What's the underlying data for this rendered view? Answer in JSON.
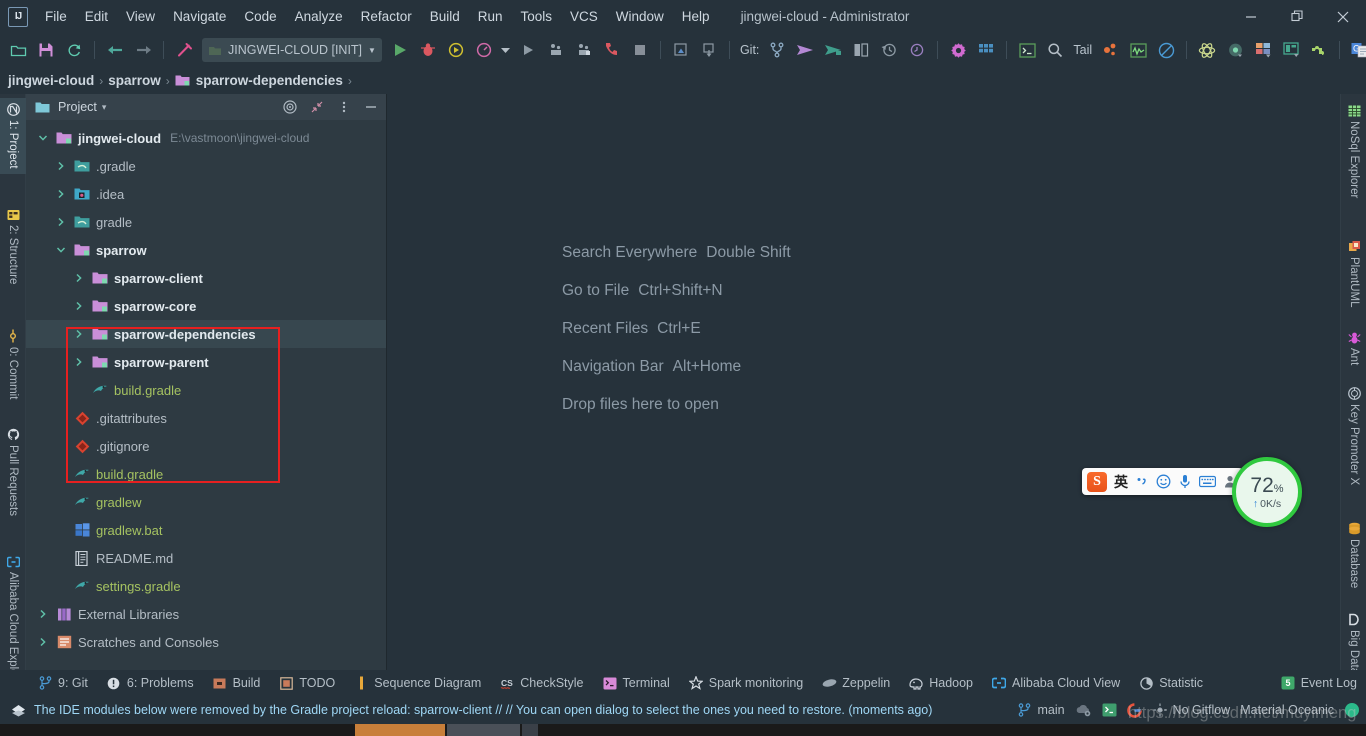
{
  "window": {
    "title": "jingwei-cloud - Administrator",
    "minimize_label": "─",
    "maximize_label": "❐",
    "close_label": "✕",
    "logo_text": "IJ"
  },
  "menubar": {
    "items": [
      {
        "label": "File",
        "mnemonic": "F"
      },
      {
        "label": "Edit",
        "mnemonic": "E"
      },
      {
        "label": "View",
        "mnemonic": "V"
      },
      {
        "label": "Navigate",
        "mnemonic": "N"
      },
      {
        "label": "Code",
        "mnemonic": "C"
      },
      {
        "label": "Analyze",
        "mnemonic": "z"
      },
      {
        "label": "Refactor",
        "mnemonic": "R"
      },
      {
        "label": "Build",
        "mnemonic": "B"
      },
      {
        "label": "Run",
        "mnemonic": "u"
      },
      {
        "label": "Tools",
        "mnemonic": "T"
      },
      {
        "label": "VCS",
        "mnemonic": "S"
      },
      {
        "label": "Window",
        "mnemonic": "W"
      },
      {
        "label": "Help",
        "mnemonic": "H"
      }
    ]
  },
  "toolbar": {
    "run_config": {
      "label": "JINGWEI-CLOUD [INIT]",
      "dropdown": "▼"
    },
    "git_label": "Git:",
    "tail_label": "Tail",
    "icons": [
      "open-folder-icon",
      "save-all-icon",
      "sync-icon",
      "back-icon",
      "forward-icon",
      "build-hammer-icon",
      "run-icon",
      "debug-icon",
      "run-with-coverage-icon",
      "profiler-icon",
      "run-anything-icon",
      "attach-profiler-icon",
      "attach-debugger-icon",
      "stop-call-icon",
      "stop-icon",
      "update-project-icon",
      "commit-icon",
      "vcs-branch-icon",
      "push-icon",
      "pull-icon",
      "compare-icon",
      "history-icon",
      "rollback-icon",
      "settings-gear-icon",
      "project-structure-icon",
      "terminal-icon",
      "search-icon",
      "tail-icon",
      "spark-icon",
      "monitor-icon",
      "no-entry-icon",
      "atom-icon",
      "circle-icon",
      "grid-colors-icon",
      "image-icon",
      "plugin-puzzle-icon",
      "google-translate-icon",
      "translate-red-icon",
      "link-icon"
    ]
  },
  "breadcrumb": {
    "items": [
      {
        "label": "jingwei-cloud",
        "has_icon": false
      },
      {
        "label": "sparrow",
        "has_icon": false
      },
      {
        "label": "sparrow-dependencies",
        "has_icon": true
      }
    ],
    "separator": "›"
  },
  "left_rail": {
    "items": [
      {
        "label": "1: Project",
        "icon": "project-icon",
        "active": true
      },
      {
        "label": "2: Structure",
        "icon": "structure-icon",
        "active": false
      },
      {
        "label": "0: Commit",
        "icon": "commit-icon",
        "active": false
      },
      {
        "label": "Pull Requests",
        "icon": "github-icon",
        "active": false
      },
      {
        "label": "Alibaba Cloud Explorer",
        "icon": "alibaba-cloud-icon",
        "active": false
      }
    ]
  },
  "right_rail": {
    "items": [
      {
        "label": "NoSql Explorer",
        "icon": "nosql-table-icon"
      },
      {
        "label": "PlantUML",
        "icon": "plantuml-icon"
      },
      {
        "label": "Ant",
        "icon": "ant-icon"
      },
      {
        "label": "Key Promoter X",
        "icon": "key-promoter-icon"
      },
      {
        "label": "Database",
        "icon": "database-icon"
      },
      {
        "label": "Big Data Tools",
        "icon": "big-data-tools-icon"
      }
    ]
  },
  "project_panel": {
    "title": "Project",
    "title_dropdown": "∨",
    "buttons": [
      {
        "name": "select-opened-file-icon",
        "label": "◎"
      },
      {
        "name": "collapse-all-icon",
        "label": "↙"
      },
      {
        "name": "options-menu-icon",
        "label": "⋮"
      },
      {
        "name": "hide-panel-icon",
        "label": "—"
      }
    ],
    "tree": [
      {
        "label": "jingwei-cloud",
        "path": "E:\\vastmoon\\jingwei-cloud",
        "depth": 0,
        "twisty": "expanded",
        "icon": "module-icon",
        "bold": true,
        "selected": false
      },
      {
        "label": ".gradle",
        "depth": 1,
        "twisty": "collapsed",
        "icon": "folder-gradle-icon",
        "bold": false,
        "selected": false,
        "color": "gray"
      },
      {
        "label": ".idea",
        "depth": 1,
        "twisty": "collapsed",
        "icon": "folder-idea-icon",
        "bold": false,
        "selected": false,
        "color": "gray"
      },
      {
        "label": "gradle",
        "depth": 1,
        "twisty": "collapsed",
        "icon": "folder-gradle-icon",
        "bold": false,
        "selected": false,
        "color": "gray"
      },
      {
        "label": "sparrow",
        "depth": 1,
        "twisty": "expanded",
        "icon": "module-icon",
        "bold": true,
        "selected": false
      },
      {
        "label": "sparrow-client",
        "depth": 2,
        "twisty": "collapsed",
        "icon": "module-icon",
        "bold": true,
        "selected": false
      },
      {
        "label": "sparrow-core",
        "depth": 2,
        "twisty": "collapsed",
        "icon": "module-icon",
        "bold": true,
        "selected": false
      },
      {
        "label": "sparrow-dependencies",
        "depth": 2,
        "twisty": "collapsed",
        "icon": "module-icon",
        "bold": true,
        "selected": true
      },
      {
        "label": "sparrow-parent",
        "depth": 2,
        "twisty": "collapsed",
        "icon": "module-icon",
        "bold": true,
        "selected": false
      },
      {
        "label": "build.gradle",
        "depth": 2,
        "twisty": "none",
        "icon": "gradle-file-icon",
        "bold": false,
        "selected": false,
        "color": "green"
      },
      {
        "label": ".gitattributes",
        "depth": 1,
        "twisty": "none",
        "icon": "git-file-icon",
        "bold": false,
        "selected": false,
        "color": "gray"
      },
      {
        "label": ".gitignore",
        "depth": 1,
        "twisty": "none",
        "icon": "git-file-icon",
        "bold": false,
        "selected": false,
        "color": "gray"
      },
      {
        "label": "build.gradle",
        "depth": 1,
        "twisty": "none",
        "icon": "gradle-file-icon",
        "bold": false,
        "selected": false,
        "color": "green"
      },
      {
        "label": "gradlew",
        "depth": 1,
        "twisty": "none",
        "icon": "gradle-file-icon",
        "bold": false,
        "selected": false,
        "color": "green"
      },
      {
        "label": "gradlew.bat",
        "depth": 1,
        "twisty": "none",
        "icon": "bat-file-icon",
        "bold": false,
        "selected": false,
        "color": "green"
      },
      {
        "label": "README.md",
        "depth": 1,
        "twisty": "none",
        "icon": "markdown-file-icon",
        "bold": false,
        "selected": false,
        "color": "gray"
      },
      {
        "label": "settings.gradle",
        "depth": 1,
        "twisty": "none",
        "icon": "gradle-file-icon",
        "bold": false,
        "selected": false,
        "color": "green"
      },
      {
        "label": "External Libraries",
        "depth": 0,
        "twisty": "collapsed",
        "icon": "libraries-icon",
        "bold": false,
        "selected": false,
        "color": "gray"
      },
      {
        "label": "Scratches and Consoles",
        "depth": 0,
        "twisty": "collapsed",
        "icon": "scratches-icon",
        "bold": false,
        "selected": false,
        "color": "gray"
      }
    ]
  },
  "editor": {
    "hints": [
      {
        "action": "Search Everywhere",
        "shortcut": "Double Shift"
      },
      {
        "action": "Go to File",
        "shortcut": "Ctrl+Shift+N"
      },
      {
        "action": "Recent Files",
        "shortcut": "Ctrl+E"
      },
      {
        "action": "Navigation Bar",
        "shortcut": "Alt+Home"
      },
      {
        "action": "Drop files here to open",
        "shortcut": ""
      }
    ]
  },
  "ime": {
    "logo": "S",
    "mode_label": "英",
    "icons": [
      "punctuation-icon",
      "emoji-icon",
      "voice-input-icon",
      "soft-keyboard-icon",
      "user-icon"
    ]
  },
  "speed_widget": {
    "percent": "72",
    "percent_unit": "%",
    "rate": "0K/s",
    "arrow": "↑",
    "ring_color": "#30c93f"
  },
  "bottom_bar": {
    "items": [
      {
        "label": "9: Git",
        "mnemonic": "9",
        "icon": "git-branch-icon"
      },
      {
        "label": "6: Problems",
        "mnemonic": "6",
        "icon": "problems-icon"
      },
      {
        "label": "Build",
        "icon": "build-icon"
      },
      {
        "label": "TODO",
        "icon": "todo-icon"
      },
      {
        "label": "Sequence Diagram",
        "icon": "sequence-diagram-icon"
      },
      {
        "label": "CheckStyle",
        "icon": "checkstyle-icon"
      },
      {
        "label": "Terminal",
        "icon": "terminal-icon"
      },
      {
        "label": "Spark monitoring",
        "icon": "spark-star-icon"
      },
      {
        "label": "Zeppelin",
        "icon": "zeppelin-icon"
      },
      {
        "label": "Hadoop",
        "icon": "hadoop-elephant-icon"
      },
      {
        "label": "Alibaba Cloud View",
        "icon": "alibaba-cloud-icon"
      },
      {
        "label": "Statistic",
        "icon": "statistic-pie-icon"
      },
      {
        "label": "Event Log",
        "icon": "event-log-icon"
      }
    ]
  },
  "status_bar": {
    "message": "The IDE modules below were removed by the Gradle project reload: sparrow-client // // You can open dialog to select the ones you need to restore. (moments ago)",
    "message_icon": "event-diamond-icon",
    "right_items": [
      {
        "label": "main",
        "icon": "git-branch-icon"
      },
      {
        "label": "",
        "icon": "cloud-settings-icon"
      },
      {
        "label": "",
        "icon": "terminal-green-icon"
      },
      {
        "label": "",
        "icon": "google-icon"
      },
      {
        "label": "No Gitflow",
        "icon": "gitflow-icon"
      },
      {
        "label": "Material Oceanic",
        "icon": "theme-icon"
      },
      {
        "label": "",
        "icon": "status-circle-icon"
      }
    ]
  },
  "watermark": {
    "text": "https://blog.csdn.net/muyimeng"
  }
}
